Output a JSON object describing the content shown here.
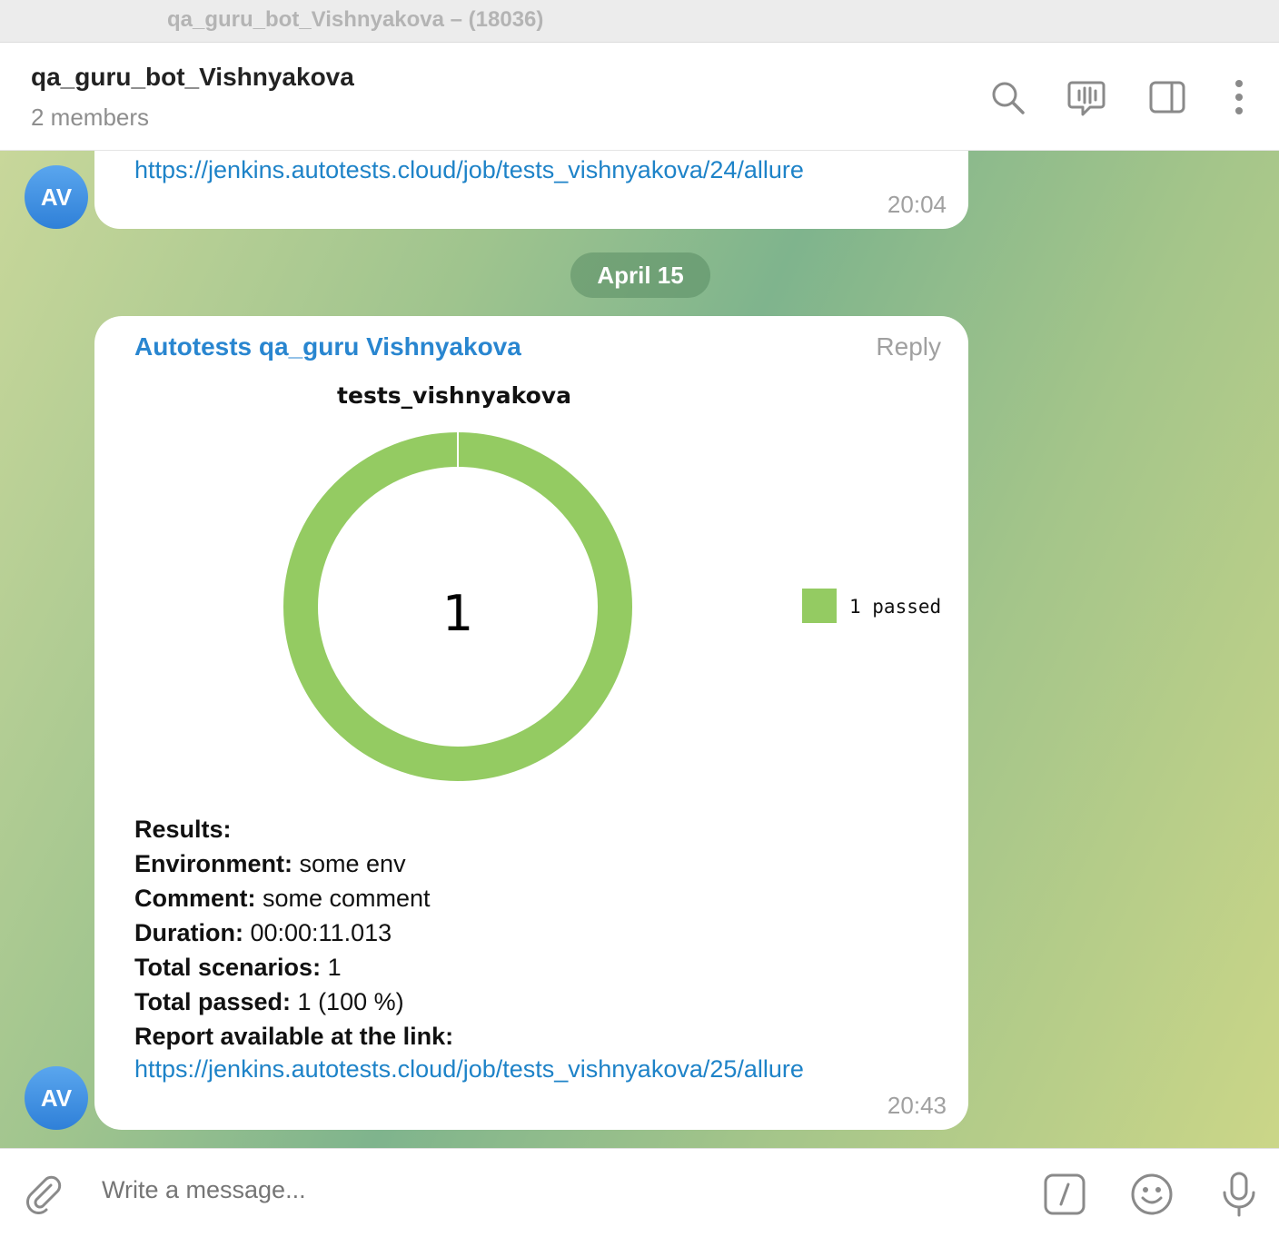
{
  "window": {
    "title": "qa_guru_bot_Vishnyakova – (18036)"
  },
  "header": {
    "title": "qa_guru_bot_Vishnyakova",
    "subtitle": "2 members",
    "icons": [
      "search-icon",
      "voice-chat-icon",
      "sidebar-toggle-icon",
      "more-icon"
    ]
  },
  "messages": [
    {
      "avatar": "AV",
      "link": "https://jenkins.autotests.cloud/job/tests_vishnyakova/24/allure",
      "time": "20:04"
    },
    {
      "avatar": "AV",
      "sender": "Autotests qa_guru Vishnyakova",
      "reply_label": "Reply",
      "results": {
        "heading": "Results:",
        "rows": [
          {
            "label": "Environment:",
            "value": " some env"
          },
          {
            "label": "Comment:",
            "value": " some comment"
          },
          {
            "label": "Duration:",
            "value": " 00:00:11.013"
          },
          {
            "label": "Total scenarios:",
            "value": " 1"
          },
          {
            "label": "Total passed:",
            "value": " 1 (100 %)"
          },
          {
            "label": "Report available at the link:",
            "value": ""
          }
        ]
      },
      "link": "https://jenkins.autotests.cloud/job/tests_vishnyakova/25/allure",
      "time": "20:43"
    }
  ],
  "date_separator": "April 15",
  "chart_data": {
    "type": "pie",
    "title": "tests_vishnyakova",
    "categories": [
      "passed"
    ],
    "values": [
      1
    ],
    "center_label": "1",
    "legend": [
      "1 passed"
    ],
    "legend_position": "right",
    "colors": [
      "#94cb62"
    ]
  },
  "composer": {
    "placeholder": "Write a message...",
    "icons": [
      "attach-icon",
      "bot-commands-icon",
      "emoji-icon",
      "microphone-icon"
    ]
  }
}
